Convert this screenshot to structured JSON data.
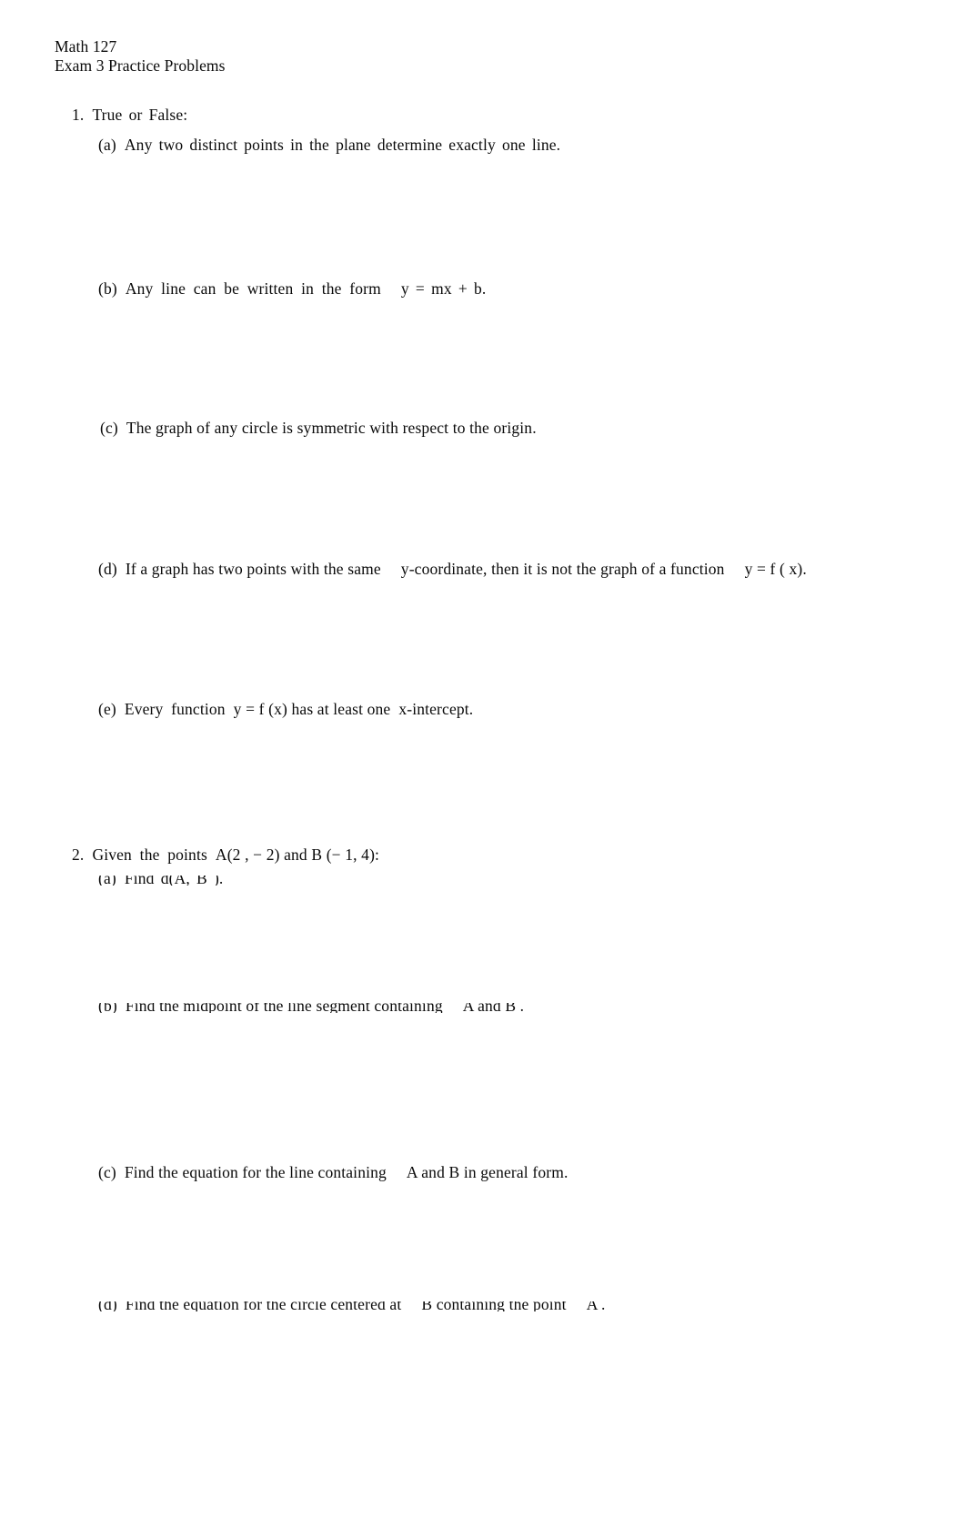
{
  "document": {
    "header": {
      "course": "Math 127",
      "title": "Exam 3 Practice Problems"
    },
    "problems": [
      {
        "number": "1.",
        "prompt": "True or False:",
        "items": [
          {
            "label": "(a)",
            "text": "Any two distinct points in the plane determine exactly one line."
          },
          {
            "label": "(b)",
            "text_before": "Any  line  can  be  written  in  the  form",
            "math": "y =  mx  + b."
          },
          {
            "label": "(c)",
            "text": "The graph of any circle is symmetric with respect to the origin."
          },
          {
            "label": "(d)",
            "text_before": "If a graph has two points with the same",
            "math_mid": "y-coordinate, then it is not the graph of a function",
            "math_end": "y =  f ( x)."
          },
          {
            "label": "(e)",
            "text_before": "Every  function",
            "math_mid": "y = f (x) has at least one",
            "math_end": "x-intercept."
          }
        ]
      },
      {
        "number": "2.",
        "prompt_before": "Given  the  points",
        "prompt_math": "A(2 , − 2) and  B (− 1, 4):",
        "items": [
          {
            "label": "(a)",
            "text": "Find  d(A, B )."
          },
          {
            "label": "(b)",
            "text_before": "Find the midpoint of the line segment containing",
            "math": "A and  B ."
          },
          {
            "label": "(c)",
            "text_before": "Find the equation for the line containing",
            "math": "A and  B in general form."
          },
          {
            "label": "(d)",
            "text_before": "Find the equation for the circle centered at",
            "math": "B  containing the point",
            "math_end": "A ."
          }
        ]
      }
    ]
  }
}
